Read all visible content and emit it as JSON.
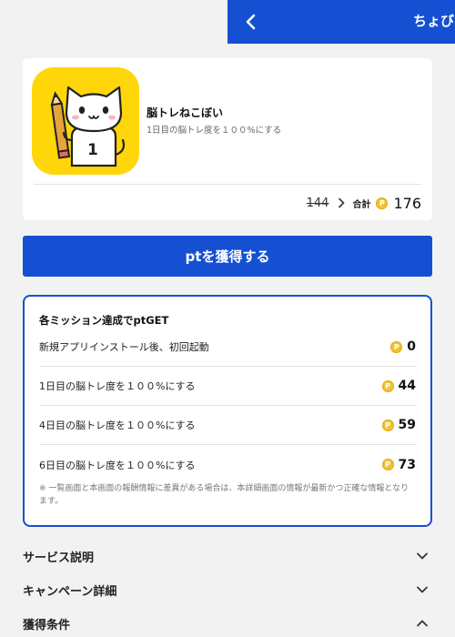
{
  "header": {
    "title": "ちょび"
  },
  "app": {
    "name": "脳トレねこぼい",
    "description": "1日目の脳トレ度を１００%にする",
    "icon_number": "1",
    "old_points": "144",
    "total_label": "合計",
    "total_points": "176"
  },
  "coin_glyph": "P",
  "cta": {
    "label": "ptを獲得する"
  },
  "missions": {
    "title": "各ミッション達成でptGET",
    "items": [
      {
        "label": "新規アプリインストール後、初回起動",
        "points": "0"
      },
      {
        "label": "1日目の脳トレ度を１００%にする",
        "points": "44"
      },
      {
        "label": "4日目の脳トレ度を１００%にする",
        "points": "59"
      },
      {
        "label": "6日目の脳トレ度を１００%にする",
        "points": "73"
      }
    ],
    "note": "※ 一覧画面と本画面の報酬情報に差異がある場合は、本詳細画面の情報が最新かつ正確な情報となります。"
  },
  "sections": {
    "service": "サービス説明",
    "campaign": "キャンペーン詳細",
    "conditions": "獲得条件"
  },
  "colors": {
    "primary": "#1550d2",
    "coin": "#f1c232",
    "icon_bg": "#ffd60a"
  }
}
